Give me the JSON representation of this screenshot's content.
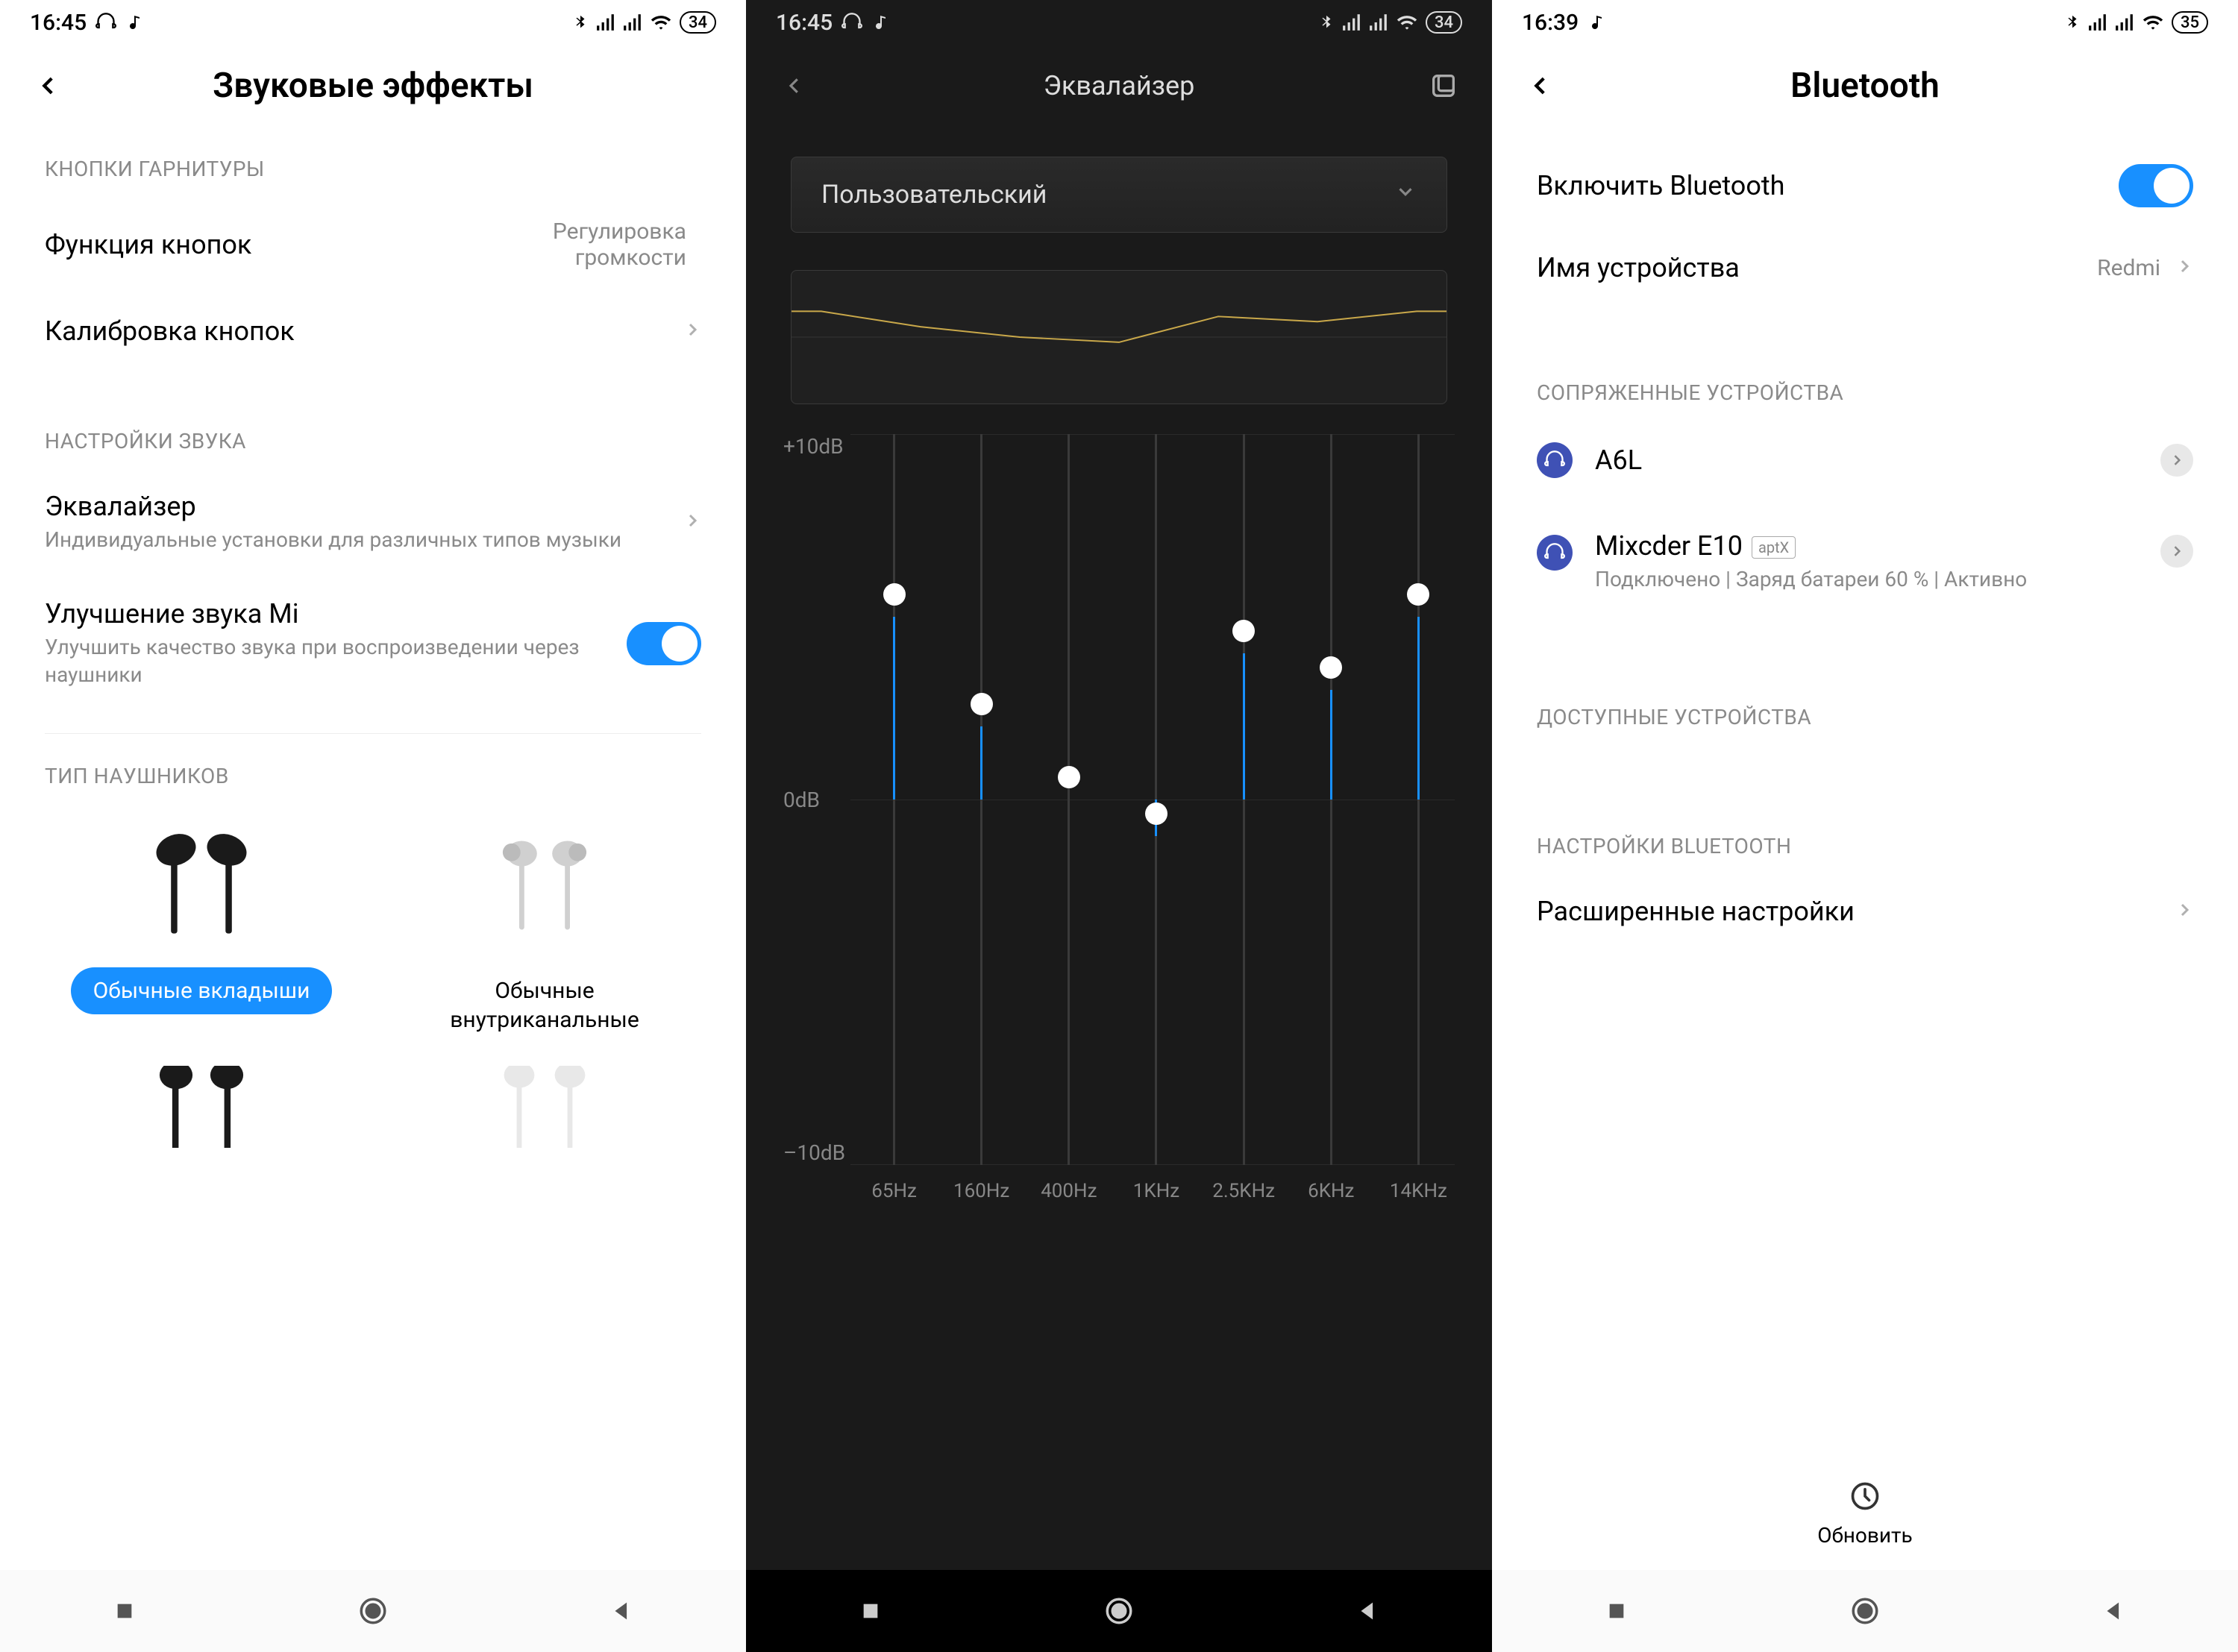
{
  "screen1": {
    "status": {
      "time": "16:45",
      "battery": "34"
    },
    "title": "Звуковые эффекты",
    "section1": "КНОПКИ ГАРНИТУРЫ",
    "row1": {
      "title": "Функция кнопок",
      "value": "Регулировка громкости"
    },
    "row2": {
      "title": "Калибровка кнопок"
    },
    "section2": "НАСТРОЙКИ ЗВУКА",
    "row3": {
      "title": "Эквалайзер",
      "sub": "Индивидуальные установки для различных типов музыки"
    },
    "row4": {
      "title": "Улучшение звука Mi",
      "sub": "Улучшить качество звука при воспроизведении через наушники"
    },
    "section3": "ТИП НАУШНИКОВ",
    "hp1": "Обычные вкладыши",
    "hp2": "Обычные внутриканальные"
  },
  "screen2": {
    "status": {
      "time": "16:45",
      "battery": "34"
    },
    "title": "Эквалайзер",
    "preset": "Пользовательский",
    "ylabels": {
      "top": "+10dB",
      "mid": "0dB",
      "bot": "–10dB"
    },
    "chart_data": {
      "type": "bar",
      "categories": [
        "65Hz",
        "160Hz",
        "400Hz",
        "1KHz",
        "2.5KHz",
        "6KHz",
        "14KHz"
      ],
      "values": [
        5,
        2,
        0,
        -1,
        4,
        3,
        5
      ],
      "ylim": [
        -10,
        10
      ],
      "ylabel": "dB"
    }
  },
  "screen3": {
    "status": {
      "time": "16:39",
      "battery": "35"
    },
    "title": "Bluetooth",
    "row1": "Включить Bluetooth",
    "row2": {
      "title": "Имя устройства",
      "value": "Redmi"
    },
    "section1": "СОПРЯЖЕННЫЕ УСТРОЙСТВА",
    "dev1": {
      "name": "A6L"
    },
    "dev2": {
      "name": "Mixcder E10",
      "badge": "aptX",
      "sub": "Подключено | Заряд батареи 60 % | Активно"
    },
    "section2": "ДОСТУПНЫЕ УСТРОЙСТВА",
    "section3": "НАСТРОЙКИ BLUETOOTH",
    "row3": "Расширенные настройки",
    "refresh": "Обновить"
  }
}
